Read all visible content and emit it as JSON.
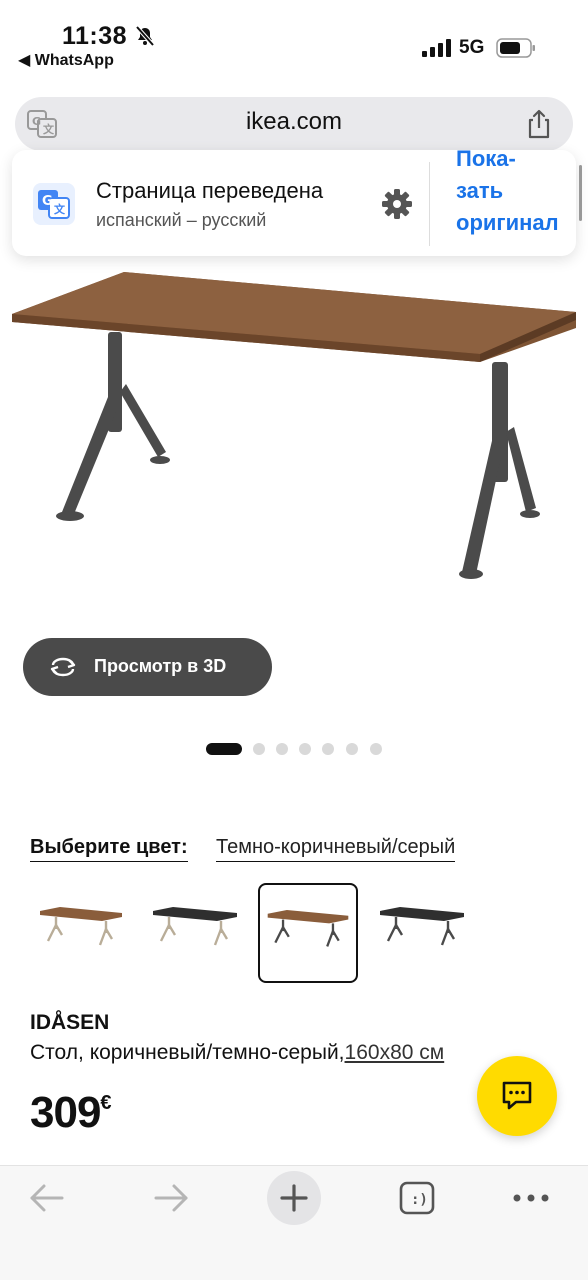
{
  "status_bar": {
    "time": "11:38",
    "back_app": "◀ WhatsApp",
    "network": "5G"
  },
  "browser": {
    "url": "ikea.com"
  },
  "translation_banner": {
    "title": "Страница переведена",
    "languages": "испанский – русский",
    "show_original": "Пока-\nзать\nоригинал"
  },
  "gallery": {
    "view_3d_label": "Просмотр в 3D",
    "total_images": 7,
    "active_index": 0
  },
  "color_selector": {
    "label": "Выберите цвет:",
    "value": "Темно-коричневый/серый",
    "swatches": [
      {
        "name": "brown-beige",
        "top": "#8a5d3b",
        "legs": "#b9ad98"
      },
      {
        "name": "black-beige",
        "top": "#2f2f2f",
        "legs": "#b9ad98"
      },
      {
        "name": "brown-darkgray",
        "top": "#8a5d3b",
        "legs": "#4a4a4a",
        "selected": true
      },
      {
        "name": "black-darkgray",
        "top": "#2f2f2f",
        "legs": "#4a4a4a"
      }
    ]
  },
  "product": {
    "name": "IDÅSEN",
    "description": "Стол, коричневый/темно-серый,",
    "size": "160x80 см",
    "price": "309",
    "currency": "€"
  },
  "colors": {
    "accent_blue": "#1a73e8",
    "chat_yellow": "#ffdb00",
    "button_dark": "#4a4a4a"
  }
}
